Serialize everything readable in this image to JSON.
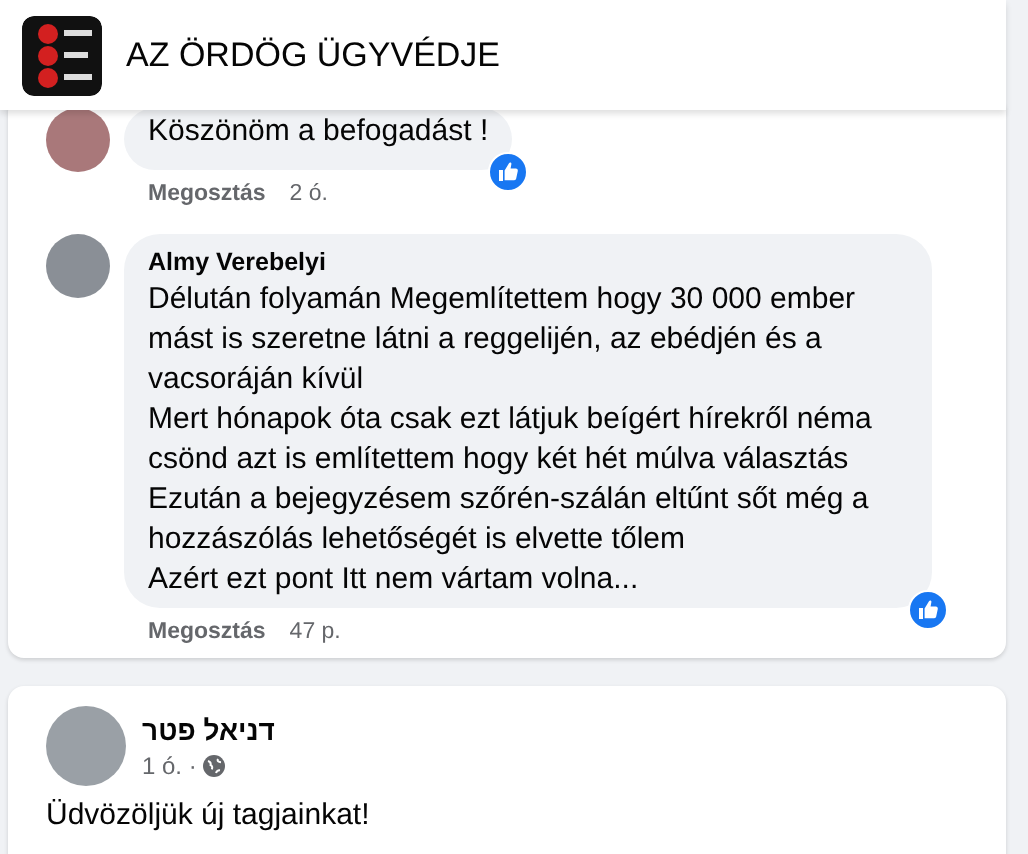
{
  "header": {
    "group_name": "AZ ÖRDÖG ÜGYVÉDJE"
  },
  "comments": [
    {
      "paragraphs": [
        "Köszönöm a befogadást !"
      ],
      "share": "Megosztás",
      "time": "2 ó.",
      "liked": true
    },
    {
      "author": "Almy Verebelyi",
      "paragraphs": [
        "Délután folyamán Megemlítettem hogy 30 000 ember mást is szeretne látni a reggelijén, az ebédjén és a vacsoráján kívül",
        "Mert hónapok óta csak ezt látjuk beígért hírekről néma csönd azt is említettem hogy két hét múlva választás",
        "Ezután a bejegyzésem szőrén-szálán eltűnt sőt még a hozzászólás lehetőségét is elvette tőlem",
        "Azért ezt pont Itt nem vártam volna..."
      ],
      "share": "Megosztás",
      "time": "47 p.",
      "liked": true
    }
  ],
  "post": {
    "author": "דניאל פטר",
    "time": "1 ó. ·",
    "text": "Üdvözöljük új tagjainkat!"
  }
}
